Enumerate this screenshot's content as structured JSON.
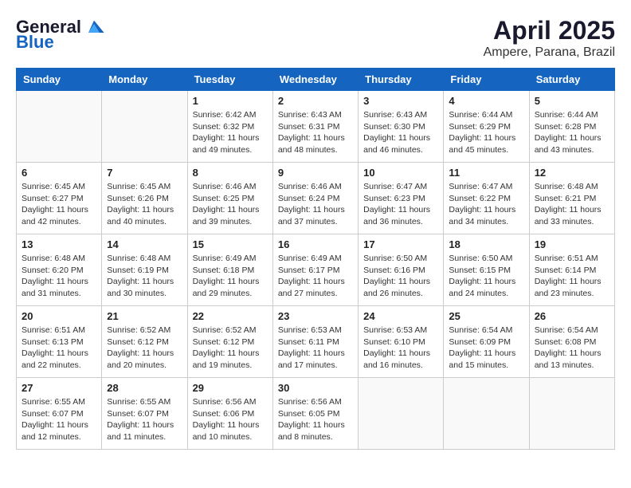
{
  "header": {
    "logo_general": "General",
    "logo_blue": "Blue",
    "month": "April 2025",
    "location": "Ampere, Parana, Brazil"
  },
  "days_of_week": [
    "Sunday",
    "Monday",
    "Tuesday",
    "Wednesday",
    "Thursday",
    "Friday",
    "Saturday"
  ],
  "weeks": [
    [
      {
        "day": "",
        "detail": ""
      },
      {
        "day": "",
        "detail": ""
      },
      {
        "day": "1",
        "detail": "Sunrise: 6:42 AM\nSunset: 6:32 PM\nDaylight: 11 hours and 49 minutes."
      },
      {
        "day": "2",
        "detail": "Sunrise: 6:43 AM\nSunset: 6:31 PM\nDaylight: 11 hours and 48 minutes."
      },
      {
        "day": "3",
        "detail": "Sunrise: 6:43 AM\nSunset: 6:30 PM\nDaylight: 11 hours and 46 minutes."
      },
      {
        "day": "4",
        "detail": "Sunrise: 6:44 AM\nSunset: 6:29 PM\nDaylight: 11 hours and 45 minutes."
      },
      {
        "day": "5",
        "detail": "Sunrise: 6:44 AM\nSunset: 6:28 PM\nDaylight: 11 hours and 43 minutes."
      }
    ],
    [
      {
        "day": "6",
        "detail": "Sunrise: 6:45 AM\nSunset: 6:27 PM\nDaylight: 11 hours and 42 minutes."
      },
      {
        "day": "7",
        "detail": "Sunrise: 6:45 AM\nSunset: 6:26 PM\nDaylight: 11 hours and 40 minutes."
      },
      {
        "day": "8",
        "detail": "Sunrise: 6:46 AM\nSunset: 6:25 PM\nDaylight: 11 hours and 39 minutes."
      },
      {
        "day": "9",
        "detail": "Sunrise: 6:46 AM\nSunset: 6:24 PM\nDaylight: 11 hours and 37 minutes."
      },
      {
        "day": "10",
        "detail": "Sunrise: 6:47 AM\nSunset: 6:23 PM\nDaylight: 11 hours and 36 minutes."
      },
      {
        "day": "11",
        "detail": "Sunrise: 6:47 AM\nSunset: 6:22 PM\nDaylight: 11 hours and 34 minutes."
      },
      {
        "day": "12",
        "detail": "Sunrise: 6:48 AM\nSunset: 6:21 PM\nDaylight: 11 hours and 33 minutes."
      }
    ],
    [
      {
        "day": "13",
        "detail": "Sunrise: 6:48 AM\nSunset: 6:20 PM\nDaylight: 11 hours and 31 minutes."
      },
      {
        "day": "14",
        "detail": "Sunrise: 6:48 AM\nSunset: 6:19 PM\nDaylight: 11 hours and 30 minutes."
      },
      {
        "day": "15",
        "detail": "Sunrise: 6:49 AM\nSunset: 6:18 PM\nDaylight: 11 hours and 29 minutes."
      },
      {
        "day": "16",
        "detail": "Sunrise: 6:49 AM\nSunset: 6:17 PM\nDaylight: 11 hours and 27 minutes."
      },
      {
        "day": "17",
        "detail": "Sunrise: 6:50 AM\nSunset: 6:16 PM\nDaylight: 11 hours and 26 minutes."
      },
      {
        "day": "18",
        "detail": "Sunrise: 6:50 AM\nSunset: 6:15 PM\nDaylight: 11 hours and 24 minutes."
      },
      {
        "day": "19",
        "detail": "Sunrise: 6:51 AM\nSunset: 6:14 PM\nDaylight: 11 hours and 23 minutes."
      }
    ],
    [
      {
        "day": "20",
        "detail": "Sunrise: 6:51 AM\nSunset: 6:13 PM\nDaylight: 11 hours and 22 minutes."
      },
      {
        "day": "21",
        "detail": "Sunrise: 6:52 AM\nSunset: 6:12 PM\nDaylight: 11 hours and 20 minutes."
      },
      {
        "day": "22",
        "detail": "Sunrise: 6:52 AM\nSunset: 6:12 PM\nDaylight: 11 hours and 19 minutes."
      },
      {
        "day": "23",
        "detail": "Sunrise: 6:53 AM\nSunset: 6:11 PM\nDaylight: 11 hours and 17 minutes."
      },
      {
        "day": "24",
        "detail": "Sunrise: 6:53 AM\nSunset: 6:10 PM\nDaylight: 11 hours and 16 minutes."
      },
      {
        "day": "25",
        "detail": "Sunrise: 6:54 AM\nSunset: 6:09 PM\nDaylight: 11 hours and 15 minutes."
      },
      {
        "day": "26",
        "detail": "Sunrise: 6:54 AM\nSunset: 6:08 PM\nDaylight: 11 hours and 13 minutes."
      }
    ],
    [
      {
        "day": "27",
        "detail": "Sunrise: 6:55 AM\nSunset: 6:07 PM\nDaylight: 11 hours and 12 minutes."
      },
      {
        "day": "28",
        "detail": "Sunrise: 6:55 AM\nSunset: 6:07 PM\nDaylight: 11 hours and 11 minutes."
      },
      {
        "day": "29",
        "detail": "Sunrise: 6:56 AM\nSunset: 6:06 PM\nDaylight: 11 hours and 10 minutes."
      },
      {
        "day": "30",
        "detail": "Sunrise: 6:56 AM\nSunset: 6:05 PM\nDaylight: 11 hours and 8 minutes."
      },
      {
        "day": "",
        "detail": ""
      },
      {
        "day": "",
        "detail": ""
      },
      {
        "day": "",
        "detail": ""
      }
    ]
  ]
}
